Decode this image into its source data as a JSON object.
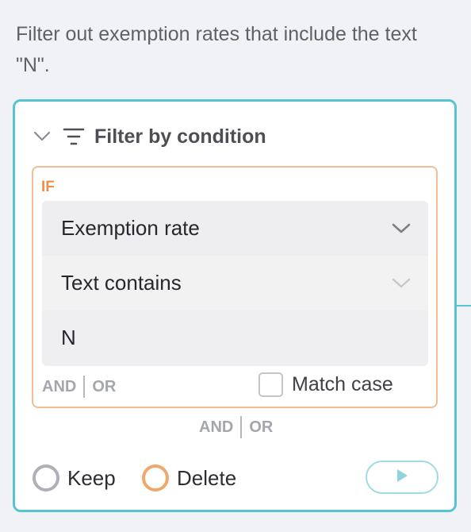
{
  "description": "Filter out exemption rates that include the text \"N\".",
  "card": {
    "title": "Filter by condition",
    "icons": {
      "collapse": "chevron-down-icon",
      "filter": "filter-icon"
    }
  },
  "condition": {
    "if_label": "IF",
    "field": "Exemption rate",
    "operator": "Text contains",
    "value": "N",
    "and_label": "AND",
    "or_label": "OR",
    "match_case_label": "Match case",
    "match_case_checked": false
  },
  "group_logic": {
    "and_label": "AND",
    "or_label": "OR"
  },
  "mode": {
    "keep_label": "Keep",
    "delete_label": "Delete",
    "selected": "Delete"
  },
  "run_button": {
    "icon": "play-icon"
  },
  "colors": {
    "accent": "#56c4d3",
    "if_border": "#f2be92",
    "if_label": "#ee8f4a",
    "delete_radio": "#efa76c"
  }
}
